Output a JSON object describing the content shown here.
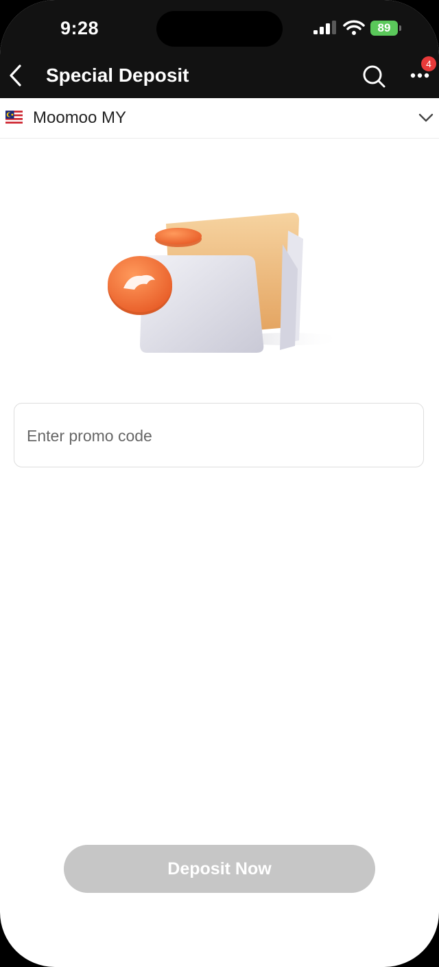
{
  "status_bar": {
    "time": "9:28",
    "battery": "89",
    "icons": [
      "cellular-signal-icon",
      "wifi-icon",
      "battery-icon"
    ]
  },
  "header": {
    "title": "Special Deposit",
    "notification_count": "4",
    "icons": [
      "chevron-left-icon",
      "search-icon",
      "more-icon"
    ]
  },
  "account": {
    "name": "Moomoo MY",
    "flag": "malaysia-flag-icon",
    "dropdown_icon": "chevron-down-icon"
  },
  "promo": {
    "placeholder": "Enter promo code",
    "value": ""
  },
  "actions": {
    "deposit_label": "Deposit Now"
  },
  "colors": {
    "header_bg": "#121212",
    "button_disabled": "#c6c6c6",
    "badge": "#e83a3a",
    "battery": "#5ac85a",
    "coin": "#f0703a"
  }
}
